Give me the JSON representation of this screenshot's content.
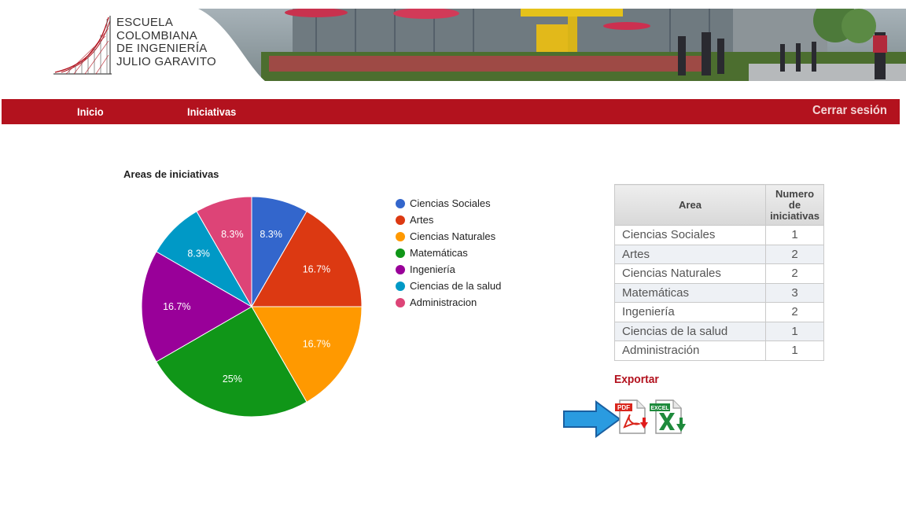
{
  "header": {
    "logo_lines": [
      "Escuela",
      "Colombiana",
      "de Ingeniería",
      "Julio Garavito"
    ]
  },
  "nav": {
    "inicio": "Inicio",
    "iniciativas": "Iniciativas",
    "logout": "Cerrar sesión"
  },
  "chart_data": {
    "type": "pie",
    "title": "Areas de iniciativas",
    "categories": [
      "Ciencias Sociales",
      "Artes",
      "Ciencias Naturales",
      "Matemáticas",
      "Ingeniería",
      "Ciencias de la salud",
      "Administracion"
    ],
    "values": [
      1,
      2,
      2,
      3,
      2,
      1,
      1
    ],
    "slice_labels": [
      "8.3%",
      "16.7%",
      "16.7%",
      "25%",
      "16.7%",
      "8.3%",
      "8.3%"
    ],
    "colors": [
      "#3366cc",
      "#dc3912",
      "#ff9900",
      "#109618",
      "#990099",
      "#0099c6",
      "#dd4477"
    ],
    "legend_position": "right"
  },
  "table": {
    "headers": [
      "Area",
      "Numero de iniciativas"
    ],
    "header_num_lines": [
      "Numero",
      "de",
      "iniciativas"
    ],
    "rows": [
      {
        "area": "Ciencias Sociales",
        "count": "1"
      },
      {
        "area": "Artes",
        "count": "2"
      },
      {
        "area": "Ciencias Naturales",
        "count": "2"
      },
      {
        "area": "Matemáticas",
        "count": "3"
      },
      {
        "area": "Ingeniería",
        "count": "2"
      },
      {
        "area": "Ciencias de la salud",
        "count": "1"
      },
      {
        "area": "Administración",
        "count": "1"
      }
    ]
  },
  "export": {
    "title": "Exportar",
    "pdf_label": "PDF",
    "excel_label": "EXCEL",
    "pointer_color": "#2a9be0"
  }
}
